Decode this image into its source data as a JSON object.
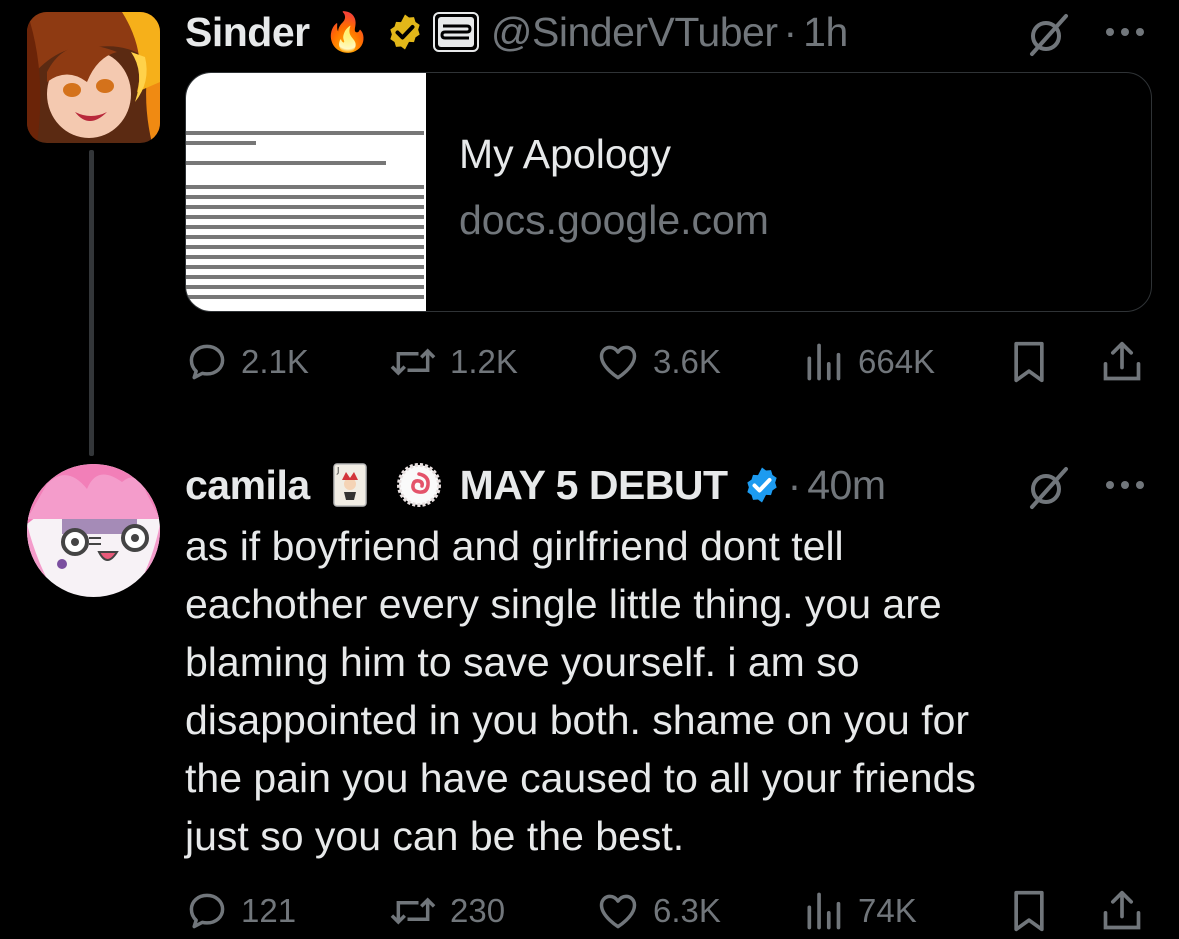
{
  "tweets": [
    {
      "author_name": "Sinder",
      "author_emoji": "🔥",
      "handle": "@SinderVTuber",
      "separator": "·",
      "time": "1h",
      "link_card": {
        "title": "My Apology",
        "domain": "docs.google.com"
      },
      "actions": {
        "replies": "2.1K",
        "reposts": "1.2K",
        "likes": "3.6K",
        "views": "664K"
      }
    },
    {
      "author_name": "camila",
      "author_suffix": "MAY 5 DEBUT",
      "separator": "·",
      "time": "40m",
      "text": "as if boyfriend and girlfriend dont tell\neachother every single little thing. you are\nblaming him to save yourself. i am so\ndisappointed in you both. shame on you for\nthe pain you have caused to all your friends\njust so you can be the best.",
      "actions": {
        "replies": "121",
        "reposts": "230",
        "likes": "6.3K",
        "views": "74K"
      }
    }
  ],
  "icons": {
    "verified_gold": "verified-gold-badge-icon",
    "verified_blue": "verified-blue-badge-icon",
    "affiliate": "affiliate-logo-icon",
    "grok": "grok-icon",
    "more": "more-dots-icon",
    "reply": "reply-icon",
    "repost": "repost-icon",
    "like": "heart-icon",
    "views": "views-bars-icon",
    "bookmark": "bookmark-icon",
    "share": "share-icon"
  },
  "colors": {
    "background": "#000000",
    "text_primary": "#e7e9ea",
    "text_secondary": "#71767b",
    "verified_blue": "#1d9bf0",
    "verified_gold": "#e2b719",
    "border": "#2f3336"
  }
}
